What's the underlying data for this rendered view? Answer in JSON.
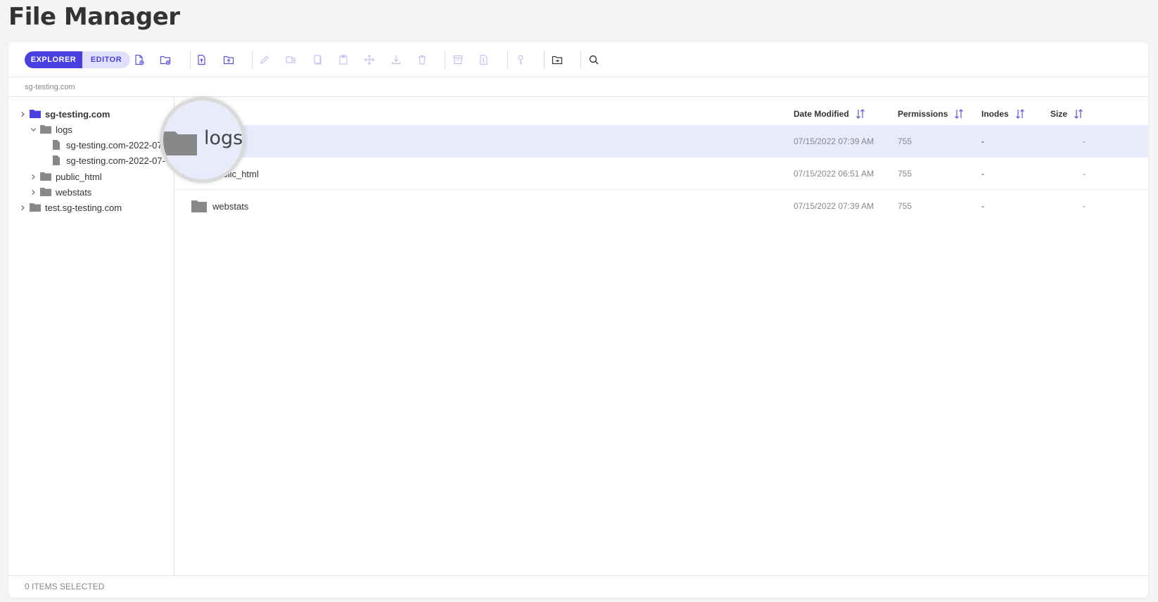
{
  "page": {
    "title": "File Manager"
  },
  "toolbar": {
    "explorer_label": "EXPLORER",
    "editor_label": "EDITOR",
    "accent_color": "#4a3fe0",
    "icons": [
      "new-file-icon",
      "new-folder-icon",
      "upload-file-icon",
      "upload-folder-icon",
      "rename-icon",
      "duplicate-icon",
      "copy-icon",
      "paste-icon",
      "move-icon",
      "download-icon",
      "delete-icon",
      "archive-icon",
      "extract-icon",
      "permissions-icon",
      "go-to-folder-icon",
      "search-icon"
    ]
  },
  "breadcrumb": {
    "path": "sg-testing.com"
  },
  "tree": {
    "items": [
      {
        "label": "sg-testing.com",
        "icon": "folder-icon",
        "expanded": false,
        "active": true
      },
      {
        "label": "logs",
        "icon": "folder-icon",
        "expanded": true
      },
      {
        "label": "sg-testing.com-2022-07-",
        "icon": "file-icon"
      },
      {
        "label": "sg-testing.com-2022-07-",
        "icon": "file-icon"
      },
      {
        "label": "public_html",
        "icon": "folder-icon",
        "expanded": false
      },
      {
        "label": "webstats",
        "icon": "folder-icon",
        "expanded": false
      },
      {
        "label": "test.sg-testing.com",
        "icon": "folder-icon",
        "expanded": false
      }
    ]
  },
  "list": {
    "columns": {
      "date_modified": "Date Modified",
      "permissions": "Permissions",
      "inodes": "Inodes",
      "size": "Size"
    },
    "rows": [
      {
        "name": "logs",
        "date": "07/15/2022 07:39 AM",
        "permissions": "755",
        "inodes": "-",
        "size": "-",
        "selected": true
      },
      {
        "name": "public_html",
        "visible_name": "html",
        "date": "07/15/2022 06:51 AM",
        "permissions": "755",
        "inodes": "-",
        "size": "-"
      },
      {
        "name": "webstats",
        "date": "07/15/2022 07:39 AM",
        "permissions": "755",
        "inodes": "-",
        "size": "-"
      }
    ]
  },
  "footer": {
    "status": "0 ITEMS SELECTED"
  },
  "magnifier": {
    "label": "logs"
  }
}
